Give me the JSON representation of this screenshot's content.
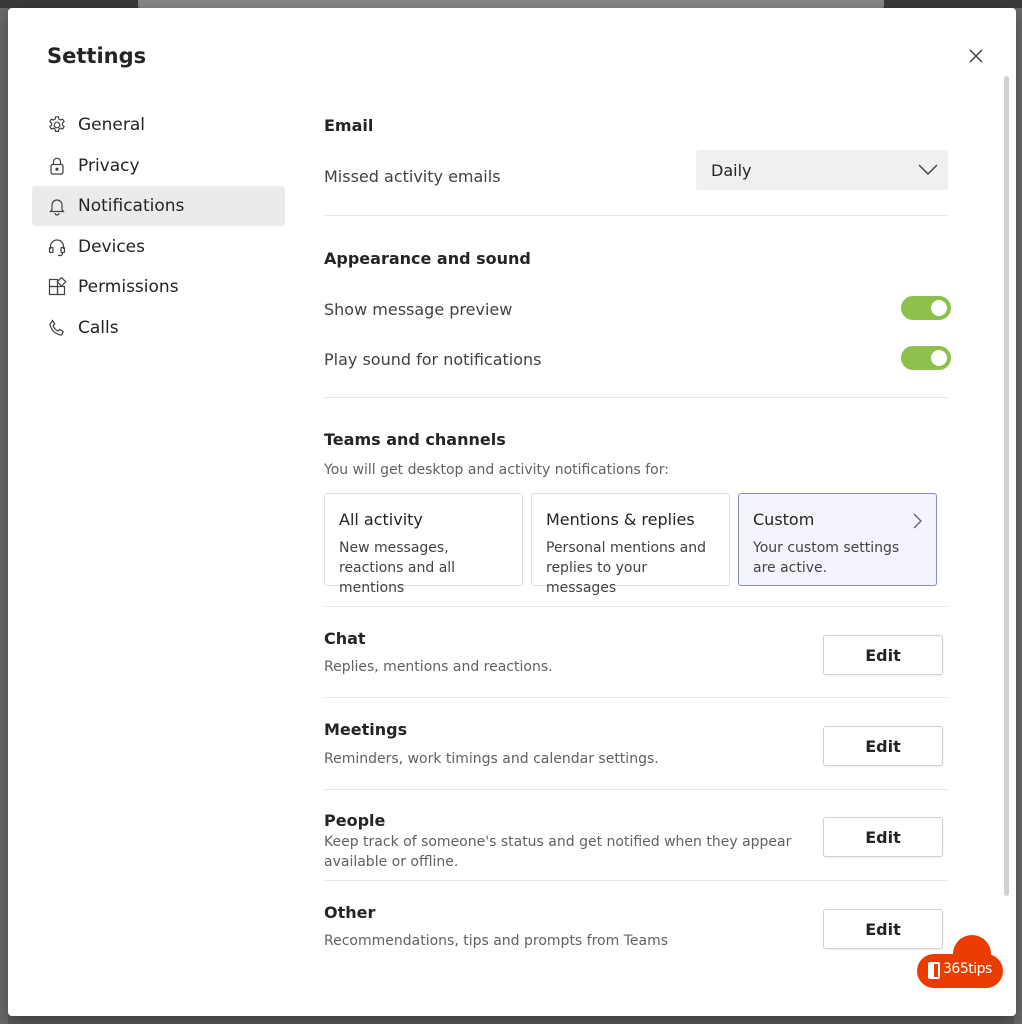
{
  "dialog": {
    "title": "Settings",
    "close_icon": "close-icon"
  },
  "sidebar": {
    "items": [
      {
        "label": "General",
        "icon": "gear-icon",
        "active": false
      },
      {
        "label": "Privacy",
        "icon": "lock-icon",
        "active": false
      },
      {
        "label": "Notifications",
        "icon": "bell-icon",
        "active": true
      },
      {
        "label": "Devices",
        "icon": "headset-icon",
        "active": false
      },
      {
        "label": "Permissions",
        "icon": "apps-icon",
        "active": false
      },
      {
        "label": "Calls",
        "icon": "phone-icon",
        "active": false
      }
    ]
  },
  "email": {
    "title": "Email",
    "missed_label": "Missed activity emails",
    "missed_value": "Daily"
  },
  "appearance": {
    "title": "Appearance and sound",
    "preview_label": "Show message preview",
    "preview_on": true,
    "sound_label": "Play sound for notifications",
    "sound_on": true,
    "toggle_color": "#8ec04e"
  },
  "teams": {
    "title": "Teams and channels",
    "description": "You will get desktop and activity notifications for:",
    "options": [
      {
        "title": "All activity",
        "desc": "New messages, reactions and all mentions",
        "selected": false
      },
      {
        "title": "Mentions & replies",
        "desc": "Personal mentions and replies to your messages",
        "selected": false
      },
      {
        "title": "Custom",
        "desc": "Your custom settings are active.",
        "selected": true
      }
    ]
  },
  "sections": [
    {
      "title": "Chat",
      "desc": "Replies, mentions and reactions.",
      "button": "Edit"
    },
    {
      "title": "Meetings",
      "desc": "Reminders, work timings and calendar settings.",
      "button": "Edit"
    },
    {
      "title": "People",
      "desc": "Keep track of someone's status and get notified when they appear available or offline.",
      "button": "Edit"
    },
    {
      "title": "Other",
      "desc": "Recommendations, tips and prompts from Teams",
      "button": "Edit"
    }
  ],
  "watermark": {
    "text": "365tips",
    "color": "#eb3c00"
  }
}
